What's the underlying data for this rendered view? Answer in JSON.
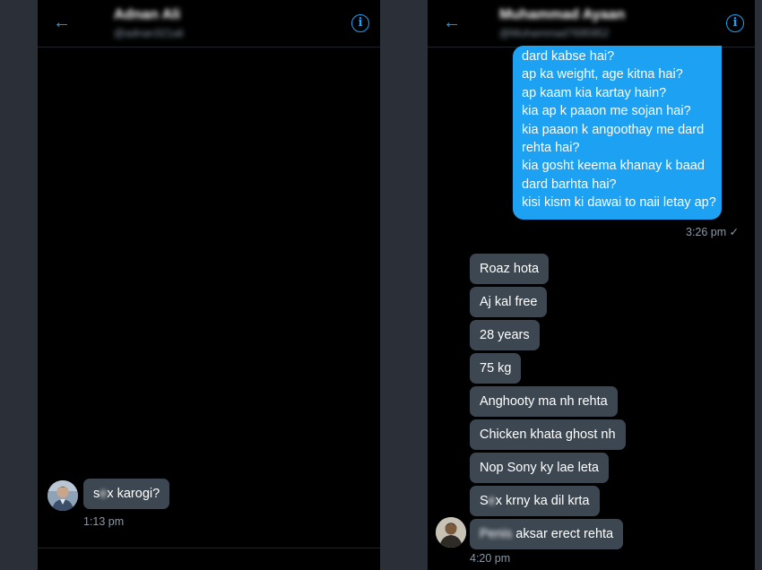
{
  "left_chat": {
    "header": {
      "name": "Adnan Ali",
      "handle": "@adnan321ali"
    },
    "messages": [
      {
        "text_prefix": "s",
        "text_blur": "e",
        "text_suffix": "x karogi?",
        "time": "1:13 pm"
      }
    ]
  },
  "right_chat": {
    "header": {
      "name": "Muhammad Ayaan",
      "handle": "@Muhammad7695952"
    },
    "outgoing": {
      "lines": [
        "dard kabse hai?",
        "ap ka weight, age kitna hai?",
        "ap kaam kia kartay hain?",
        "kia ap k paaon me sojan hai?",
        "kia paaon k angoothay me dard",
        "rehta hai?",
        "kia gosht keema khanay k baad",
        "dard barhta hai?",
        "kisi kism ki dawai to naii letay ap?"
      ],
      "time": "3:26 pm",
      "status": "✓"
    },
    "incoming": [
      "Roaz hota",
      "Aj kal free",
      "28 years",
      "75 kg",
      "Anghooty ma nh rehta",
      "Chicken khata ghost nh",
      "Nop Sony ky lae leta",
      {
        "prefix": "S",
        "blur": "e",
        "suffix": "x krny ka dil krta"
      },
      {
        "blur": "Penis",
        "suffix": " aksar erect rehta"
      }
    ],
    "last_time": "4:20 pm"
  },
  "colors": {
    "accent": "#1da1f2",
    "incoming_bubble": "#3d4751",
    "background": "#000000",
    "gutter": "#2b3038",
    "muted": "#8899a6"
  }
}
